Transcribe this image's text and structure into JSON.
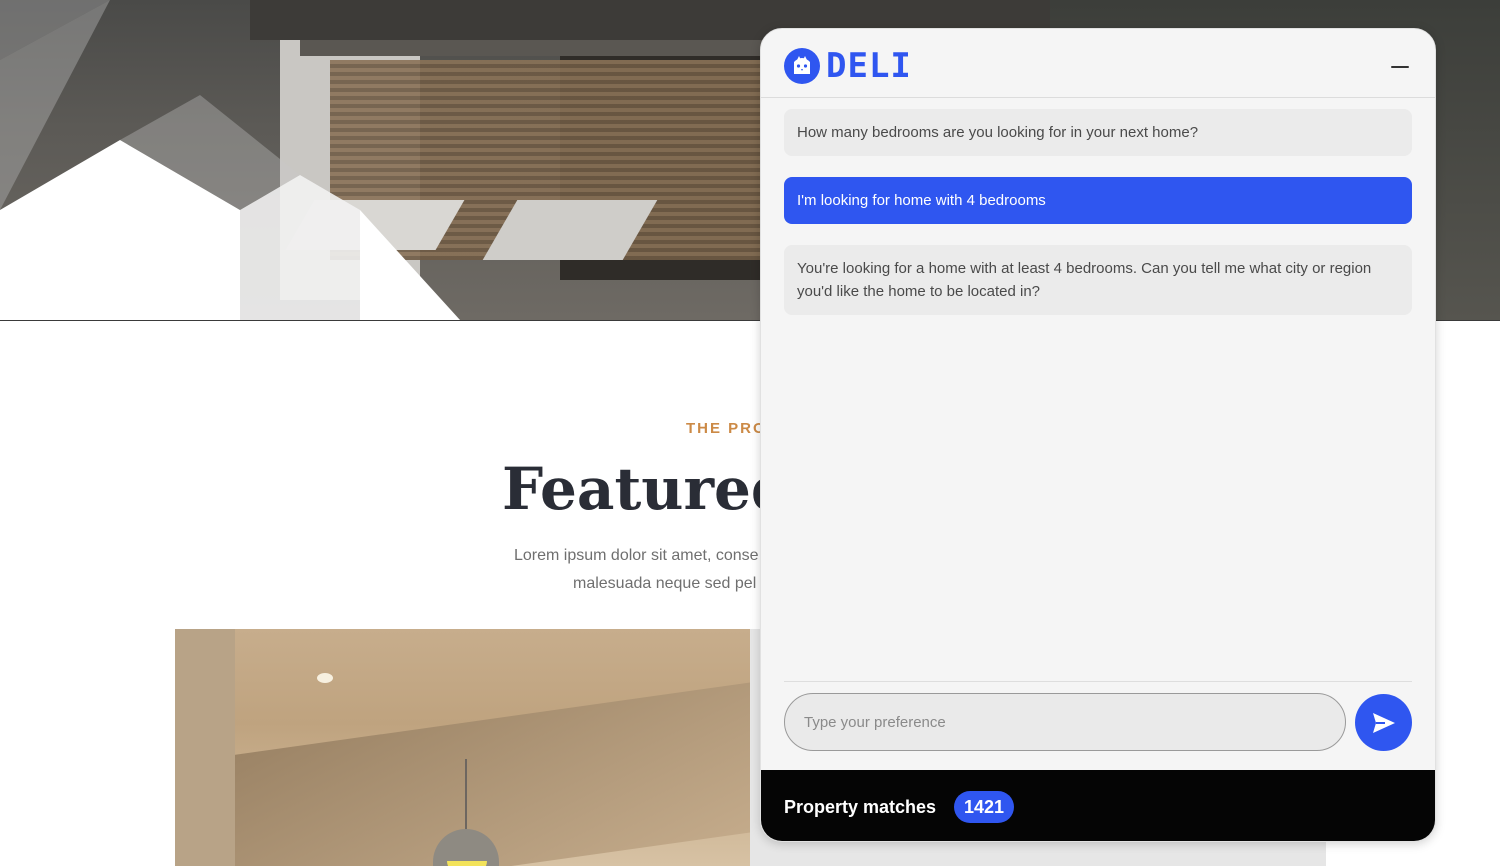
{
  "background": {
    "tagline": "THE PRO",
    "title": "Featured P",
    "description_line1": "Lorem ipsum dolor sit amet, conse",
    "description_line2": "malesuada neque sed pel"
  },
  "widget": {
    "brand": "DELI",
    "logo_icon": "owl-icon",
    "minimize_icon": "minimize-icon",
    "messages": [
      {
        "role": "bot",
        "text": "How many bedrooms are you looking for in your next home?"
      },
      {
        "role": "user",
        "text": "I'm looking for home with 4 bedrooms"
      },
      {
        "role": "bot",
        "text": "You're looking for a home with at least 4 bedrooms. Can you tell me what city or region you'd like the home to be located in?"
      }
    ],
    "input": {
      "placeholder": "Type your preference",
      "value": ""
    },
    "send_icon": "send-icon",
    "footer": {
      "label": "Property matches",
      "count": "1421"
    }
  },
  "colors": {
    "accent": "#2f56f0",
    "tagline": "#cc8a46",
    "footer_bg": "#050505"
  }
}
